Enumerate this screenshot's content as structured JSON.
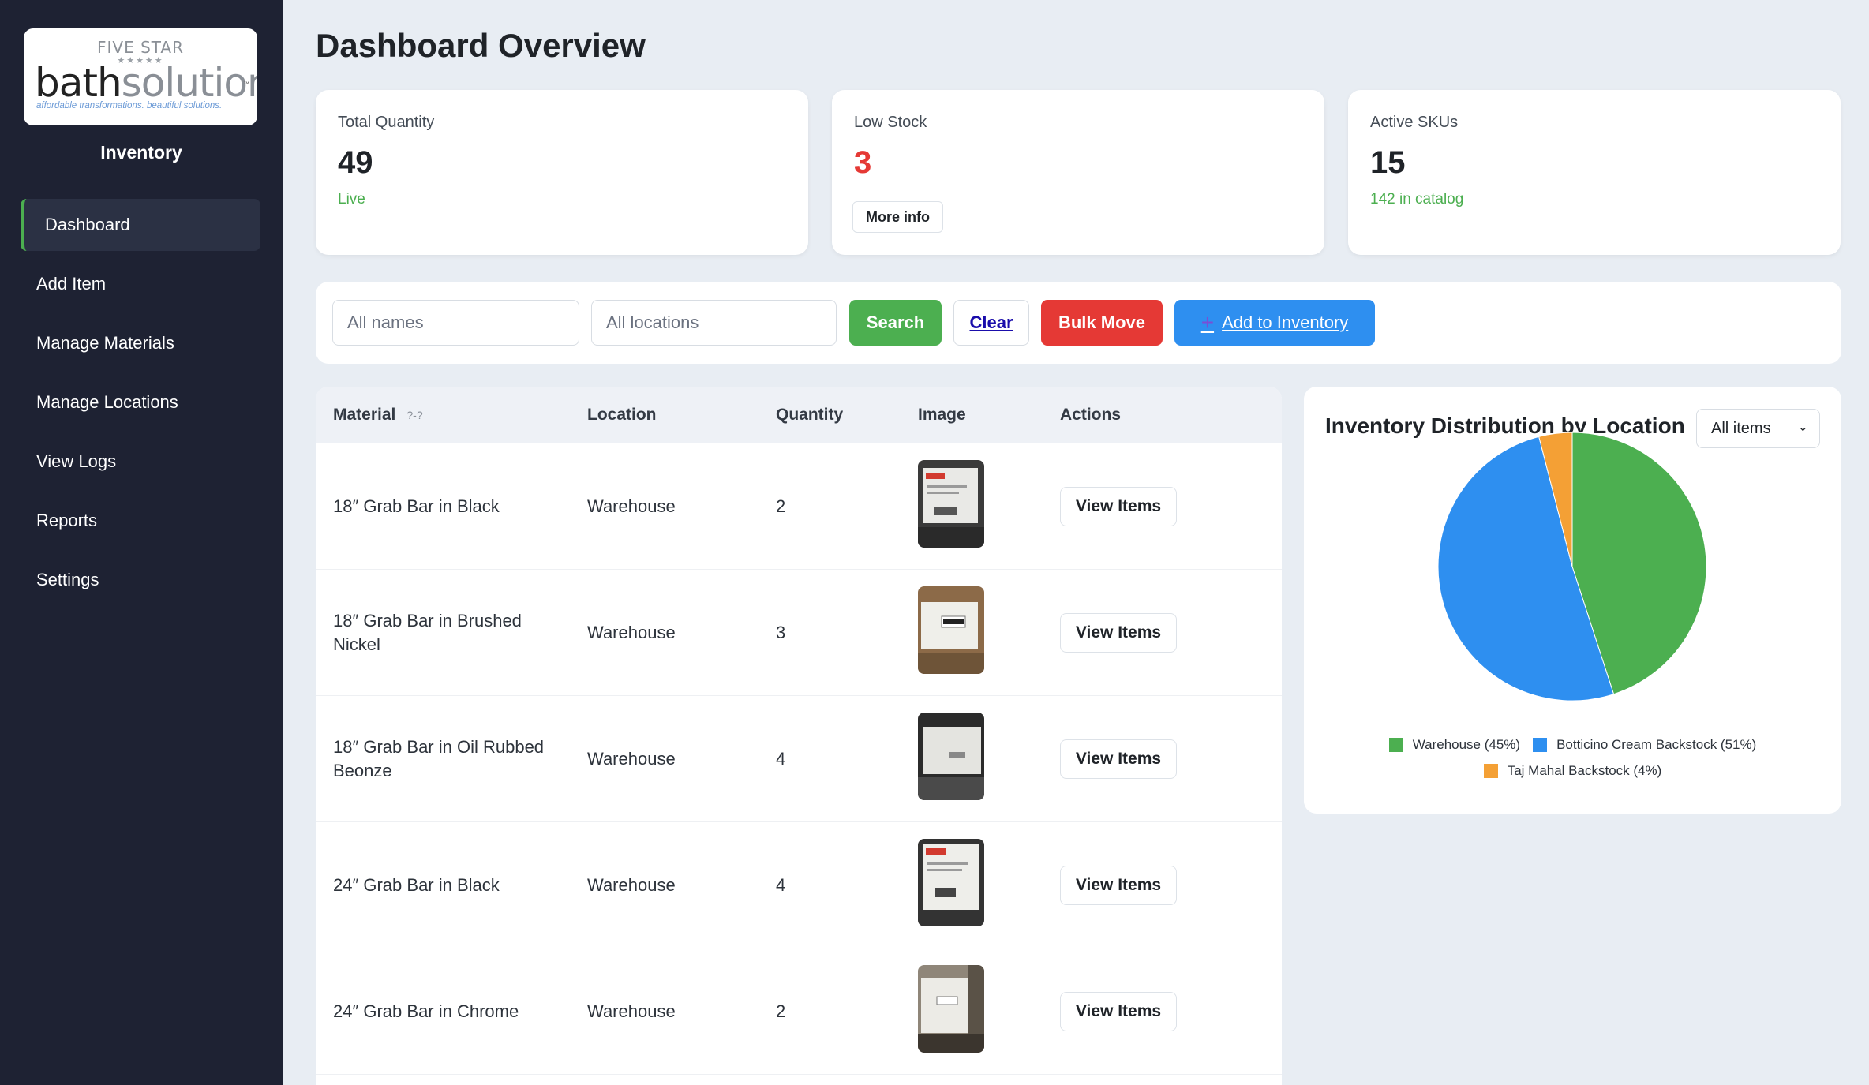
{
  "sidebar": {
    "logo": {
      "top": "FIVE STAR",
      "stars": "★★★★★",
      "brand_a": "bath",
      "brand_b": "solutions",
      "tagline": "affordable transformations. beautiful solutions."
    },
    "title": "Inventory",
    "items": [
      {
        "label": "Dashboard",
        "active": true
      },
      {
        "label": "Add Item"
      },
      {
        "label": "Manage Materials"
      },
      {
        "label": "Manage Locations"
      },
      {
        "label": "View Logs"
      },
      {
        "label": "Reports"
      },
      {
        "label": "Settings"
      }
    ]
  },
  "main": {
    "title": "Dashboard Overview",
    "stats": [
      {
        "label": "Total Quantity",
        "value": "49",
        "sub": "Live"
      },
      {
        "label": "Low Stock",
        "value": "3",
        "button": "More info",
        "value_color": "#e53935"
      },
      {
        "label": "Active SKUs",
        "value": "15",
        "sub": "142 in catalog"
      }
    ],
    "filters": {
      "name_placeholder": "All names",
      "location_placeholder": "All locations",
      "search": "Search",
      "clear": "Clear",
      "bulk_move": "Bulk Move",
      "add_icon": "+",
      "add": "Add to Inventory"
    },
    "table": {
      "headers": {
        "material": "Material",
        "sort_hint": "?-?",
        "location": "Location",
        "quantity": "Quantity",
        "image": "Image",
        "actions": "Actions"
      },
      "rows": [
        {
          "material": "18″ Grab Bar in Black",
          "location": "Warehouse",
          "quantity": "2",
          "action": "View Items"
        },
        {
          "material": "18″ Grab Bar in Brushed Nickel",
          "location": "Warehouse",
          "quantity": "3",
          "action": "View Items"
        },
        {
          "material": "18″ Grab Bar in Oil Rubbed Beonze",
          "location": "Warehouse",
          "quantity": "4",
          "action": "View Items"
        },
        {
          "material": "24″ Grab Bar in Black",
          "location": "Warehouse",
          "quantity": "4",
          "action": "View Items"
        },
        {
          "material": "24″ Grab Bar in Chrome",
          "location": "Warehouse",
          "quantity": "2",
          "action": "View Items"
        }
      ]
    },
    "chart_panel": {
      "title": "Inventory Distribution by Location",
      "select_value": "All items"
    }
  },
  "chart_data": {
    "type": "pie",
    "title": "Inventory Distribution by Location",
    "slices": [
      {
        "label": "Warehouse (45%)",
        "value": 45,
        "color": "#4caf50"
      },
      {
        "label": "Botticino Cream Backstock (51%)",
        "value": 51,
        "color": "#2e8ff0"
      },
      {
        "label": "Taj Mahal Backstock (4%)",
        "value": 4,
        "color": "#f4a035"
      }
    ],
    "legend_position": "bottom"
  },
  "colors": {
    "sidebar_bg": "#1e2233",
    "accent_green": "#4caf50",
    "danger_red": "#e53935",
    "primary_blue": "#2e8ff0",
    "page_bg": "#e8edf3"
  }
}
